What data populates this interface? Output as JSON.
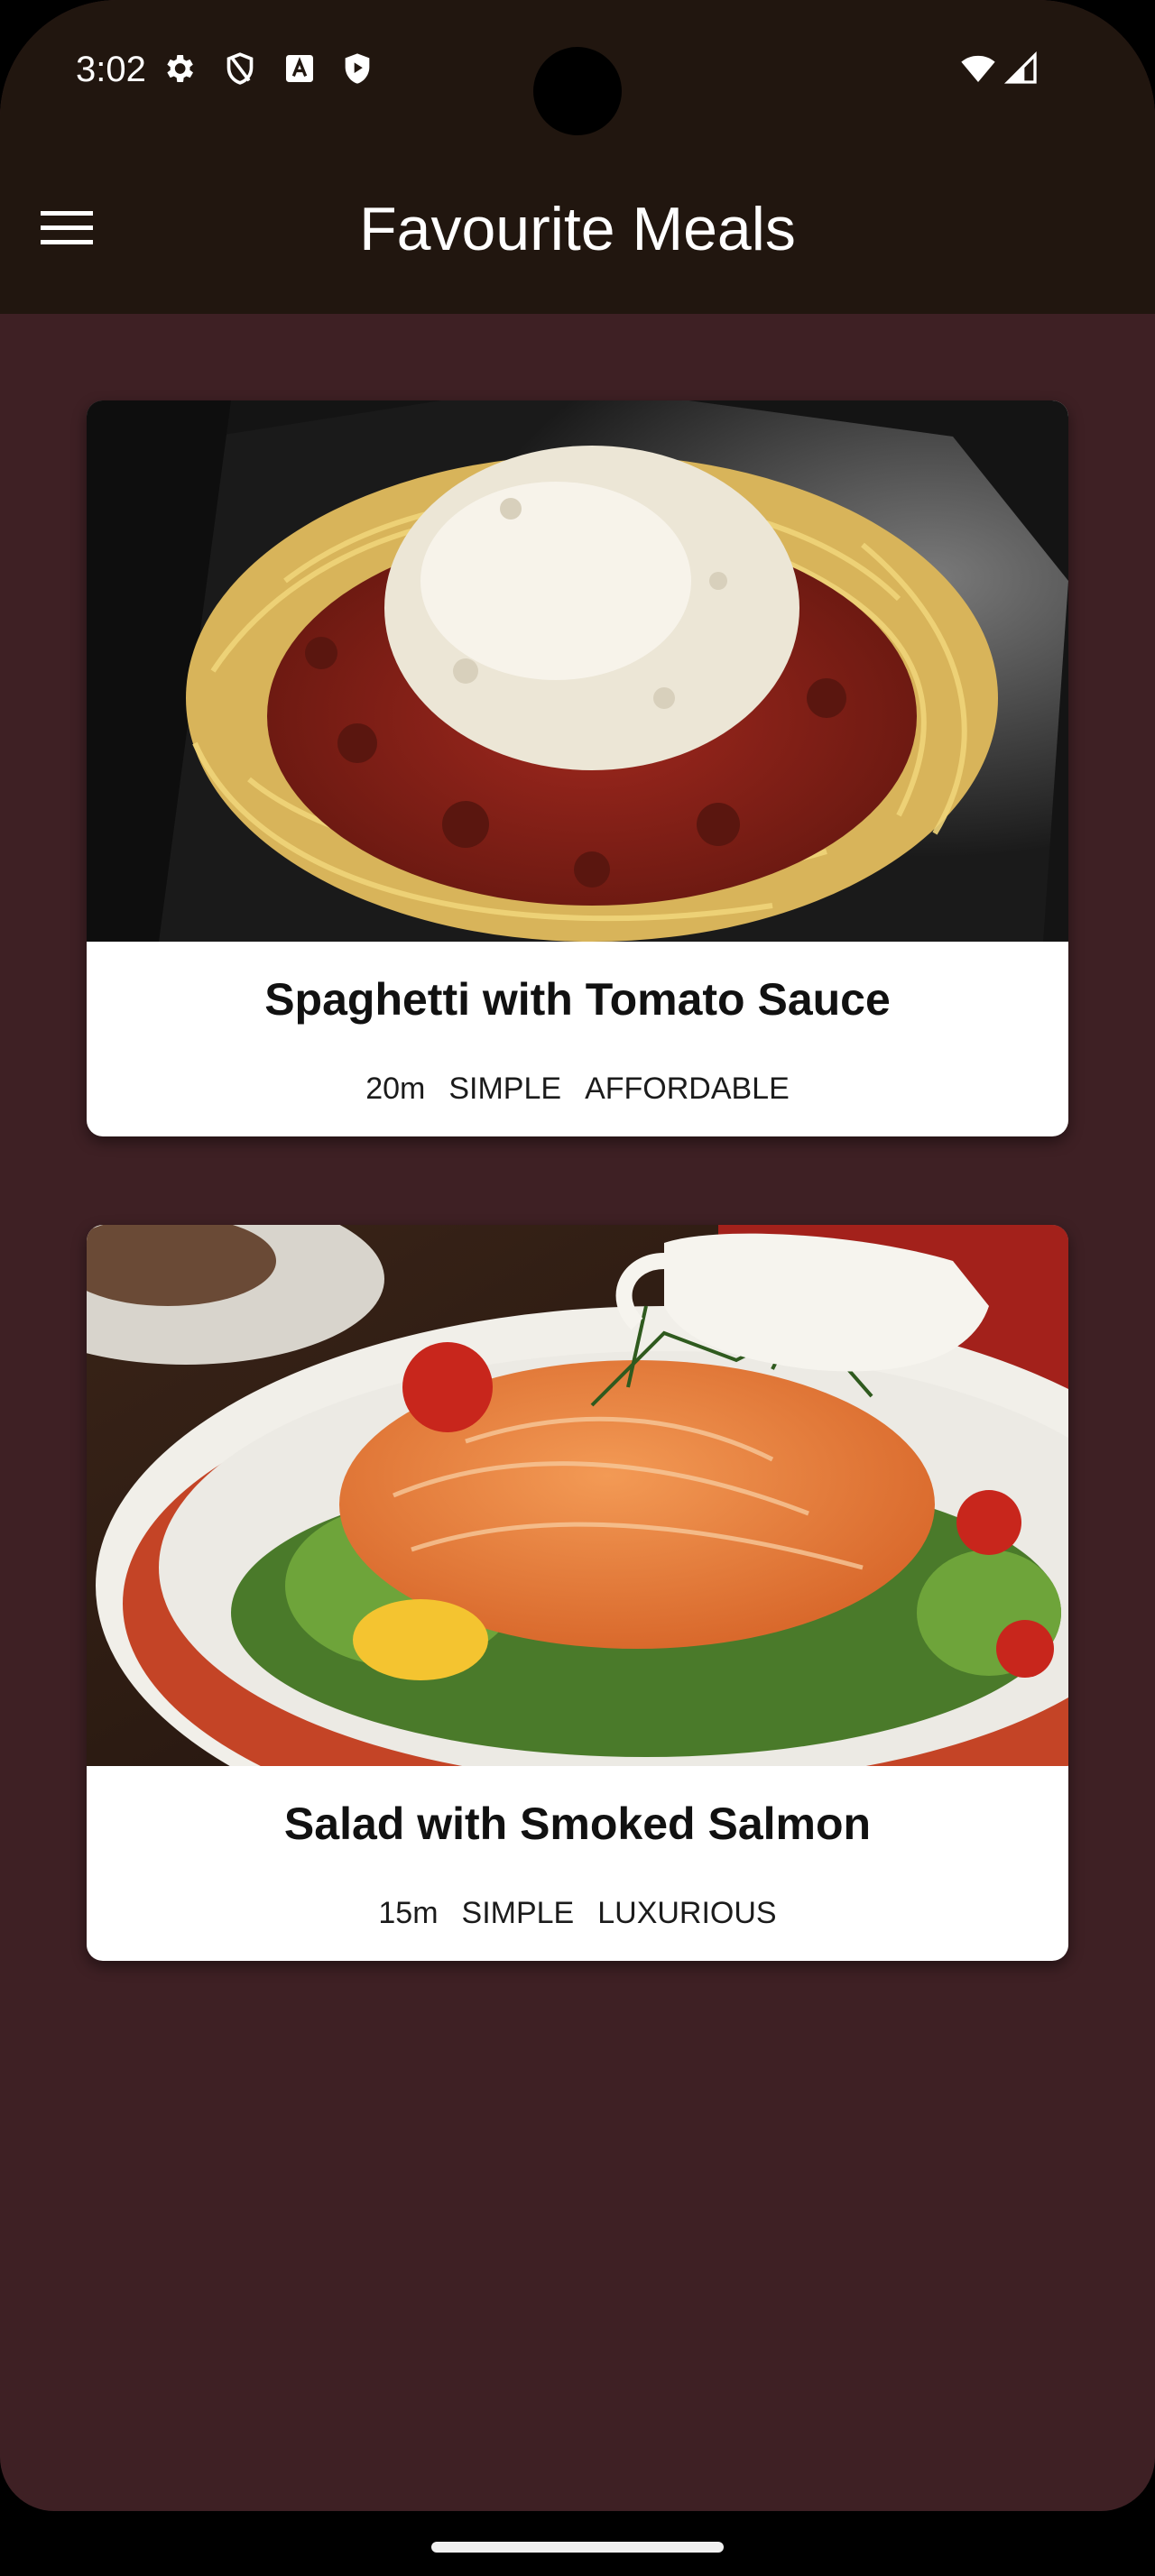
{
  "status_bar": {
    "time": "3:02",
    "icons": [
      "gear-icon",
      "shield-icon",
      "text-a-icon",
      "play-shield-icon",
      "wifi-icon",
      "signal-icon"
    ]
  },
  "app_bar": {
    "title": "Favourite Meals",
    "menu_icon": "hamburger-menu-icon"
  },
  "meals": [
    {
      "title": "Spaghetti with Tomato Sauce",
      "duration": "20m",
      "complexity": "SIMPLE",
      "affordability": "AFFORDABLE"
    },
    {
      "title": "Salad with Smoked Salmon",
      "duration": "15m",
      "complexity": "SIMPLE",
      "affordability": "LUXURIOUS"
    }
  ],
  "colors": {
    "app_bar": "#21160f",
    "background": "#3e2024",
    "card": "#ffffff"
  }
}
